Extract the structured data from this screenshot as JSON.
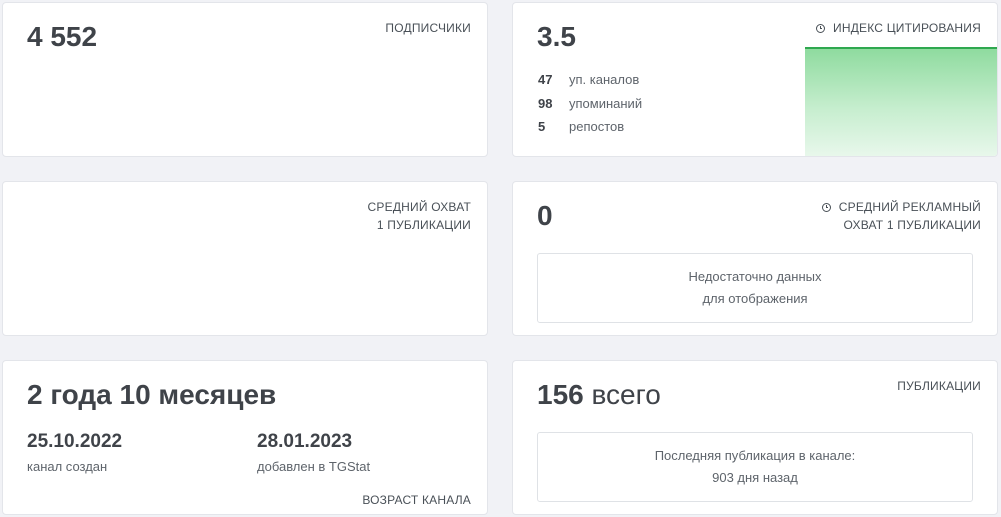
{
  "subscribers": {
    "value": "4 552",
    "caption": "ПОДПИСЧИКИ"
  },
  "citation": {
    "value": "3.5",
    "caption": "ИНДЕКС ЦИТИРОВАНИЯ",
    "info_icon": "clock-icon",
    "stats": [
      {
        "num": "47",
        "label": "уп. каналов"
      },
      {
        "num": "98",
        "label": "упоминаний"
      },
      {
        "num": "5",
        "label": "репостов"
      }
    ],
    "chart_color": "#2fa84f"
  },
  "avg_reach": {
    "caption_line1": "СРЕДНИЙ ОХВАТ",
    "caption_line2": "1 ПУБЛИКАЦИИ"
  },
  "ad_reach": {
    "value": "0",
    "caption_line1": "СРЕДНИЙ РЕКЛАМНЫЙ",
    "caption_line2": "ОХВАТ 1 ПУБЛИКАЦИИ",
    "info_icon": "clock-icon",
    "empty_line1": "Недостаточно данных",
    "empty_line2": "для отображения"
  },
  "age": {
    "value": "2 года 10 месяцев",
    "created_date": "25.10.2022",
    "created_label": "канал создан",
    "added_date": "28.01.2023",
    "added_label": "добавлен в TGStat",
    "caption": "ВОЗРАСТ КАНАЛА"
  },
  "posts": {
    "value": "156",
    "suffix": "всего",
    "caption": "ПУБЛИКАЦИИ",
    "last_line1": "Последняя публикация в канале:",
    "last_line2": "903 дня назад"
  }
}
